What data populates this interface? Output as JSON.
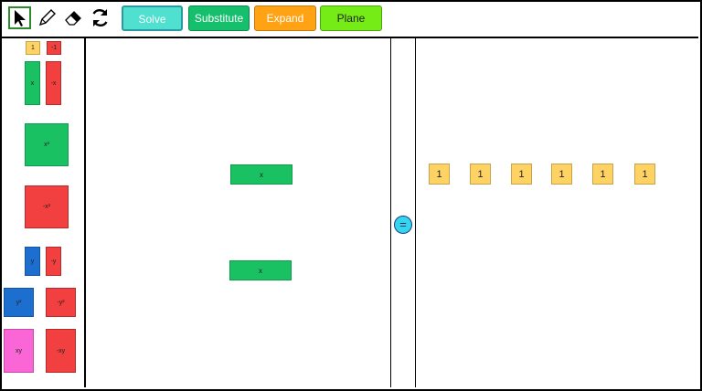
{
  "toolbar": {
    "buttons": {
      "solve": "Solve",
      "substitute": "Substitute",
      "expand": "Expand",
      "plane": "Plane"
    },
    "colors": {
      "solve": "#4fe0cf",
      "substitute": "#15bf6c",
      "expand": "#ffa214",
      "plane": "#76ec16"
    }
  },
  "palette": {
    "unit_pos": "1",
    "unit_neg": "-1",
    "x_pos": "x",
    "x_neg": "-x",
    "x2_pos": "x²",
    "x2_neg": "-x²",
    "y_pos": "y",
    "y_neg": "-y",
    "y2_pos": "y²",
    "y2_neg": "-y²",
    "xy_pos": "xy",
    "xy_neg": "-xy"
  },
  "left_side": {
    "tiles": [
      "x",
      "x"
    ]
  },
  "equals_symbol": "=",
  "right_side": {
    "units": [
      "1",
      "1",
      "1",
      "1",
      "1",
      "1"
    ]
  }
}
